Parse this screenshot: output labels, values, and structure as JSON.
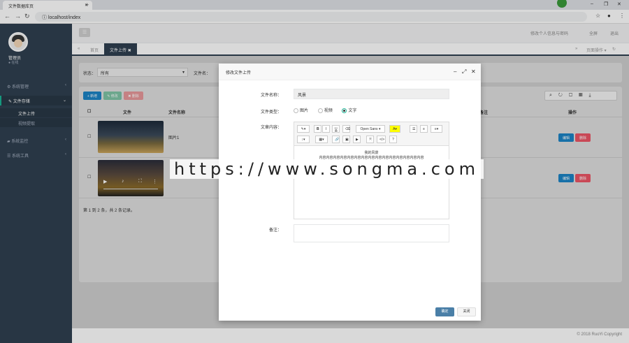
{
  "browser": {
    "tab_title": "文件数据库页",
    "url": "localhost/index"
  },
  "sidebar": {
    "user_name": "管理员",
    "user_status": "● 在线",
    "items": [
      {
        "label": "系统管理"
      },
      {
        "label": "文件存储"
      },
      {
        "label": "系统监控"
      },
      {
        "label": "系统工具"
      }
    ],
    "subitems": [
      {
        "label": "文件上传"
      },
      {
        "label": "视频提取"
      }
    ]
  },
  "topbar": {
    "links": [
      "修改个人信息与密码",
      "全屏",
      "退出"
    ]
  },
  "pagetabs": {
    "home": "首页",
    "active": "文件上传",
    "right_label": "页面操作"
  },
  "content": {
    "search_label_1": "状态：",
    "search_value_1": "所有",
    "search_label_2": "文件名：",
    "buttons": [
      "新增",
      "修改",
      "删除"
    ],
    "columns": [
      "文件",
      "文件名称",
      "备注",
      "操作"
    ],
    "rows": [
      {
        "name": "图片1"
      },
      {
        "name": ""
      }
    ],
    "row_actions": [
      "编辑",
      "删除"
    ],
    "pager": "第 1 到 2 条，共 2 条记录。"
  },
  "modal": {
    "title": "修改文件上传",
    "name_label": "文件名称：",
    "name_value": "风景",
    "type_label": "文件类型：",
    "types": [
      "图片",
      "视频",
      "文字"
    ],
    "selected_type": "文字",
    "content_label": "文章内容：",
    "font_name": "Open Sans",
    "editor_heading": "我的风景",
    "editor_line": "内容内容内容内容内容内容内容内容内容内容内容内容内容内容内容",
    "remark_label": "备注：",
    "ok": "确定",
    "close": "关闭"
  },
  "watermark": "https://www.songma.com",
  "footer": "© 2018 RuoYi Copyright"
}
